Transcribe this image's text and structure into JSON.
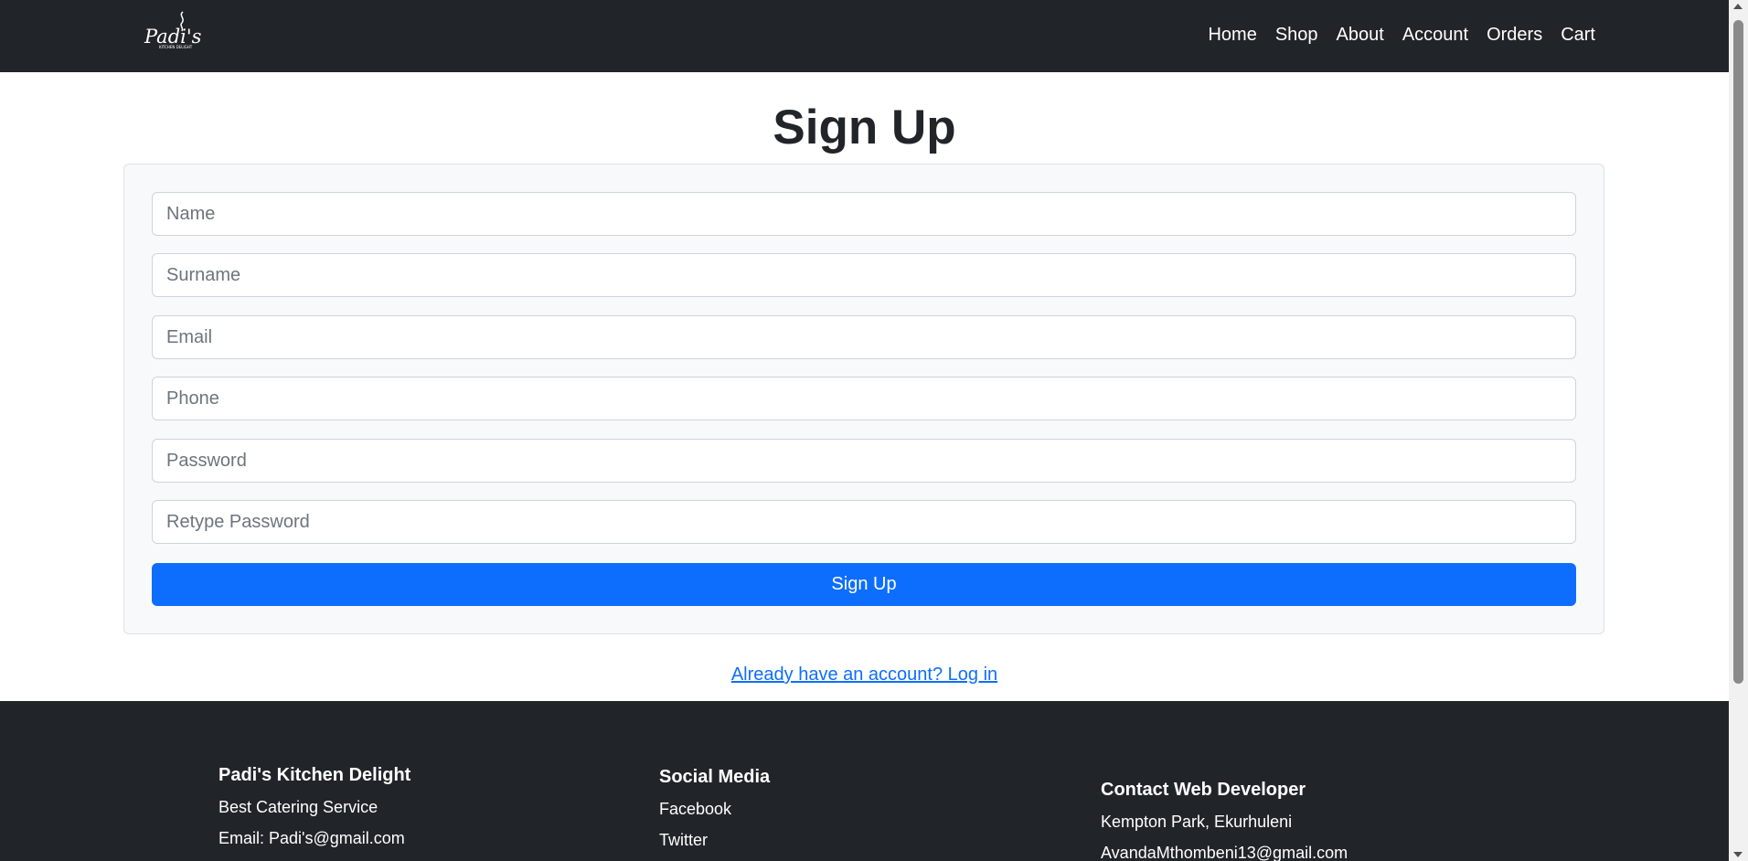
{
  "navbar": {
    "logo_text": "Padi's",
    "logo_subtext": "KITCHEN DELIGHT",
    "links": [
      "Home",
      "Shop",
      "About",
      "Account",
      "Orders",
      "Cart"
    ]
  },
  "page": {
    "title": "Sign Up"
  },
  "form": {
    "fields": {
      "name": "Name",
      "surname": "Surname",
      "email": "Email",
      "phone": "Phone",
      "password": "Password",
      "retype_password": "Retype Password"
    },
    "submit_label": "Sign Up"
  },
  "login_link": "Already have an account? Log in",
  "footer": {
    "brand": {
      "heading": "Padi's Kitchen Delight",
      "tagline": "Best Catering Service",
      "email": "Email: Padi's@gmail.com"
    },
    "social": {
      "heading": "Social Media",
      "facebook": "Facebook",
      "twitter": "Twitter"
    },
    "contact": {
      "heading": "Contact Web Developer",
      "location": "Kempton Park, Ekurhuleni",
      "email": "AvandaMthombeni13@gmail.com"
    }
  }
}
